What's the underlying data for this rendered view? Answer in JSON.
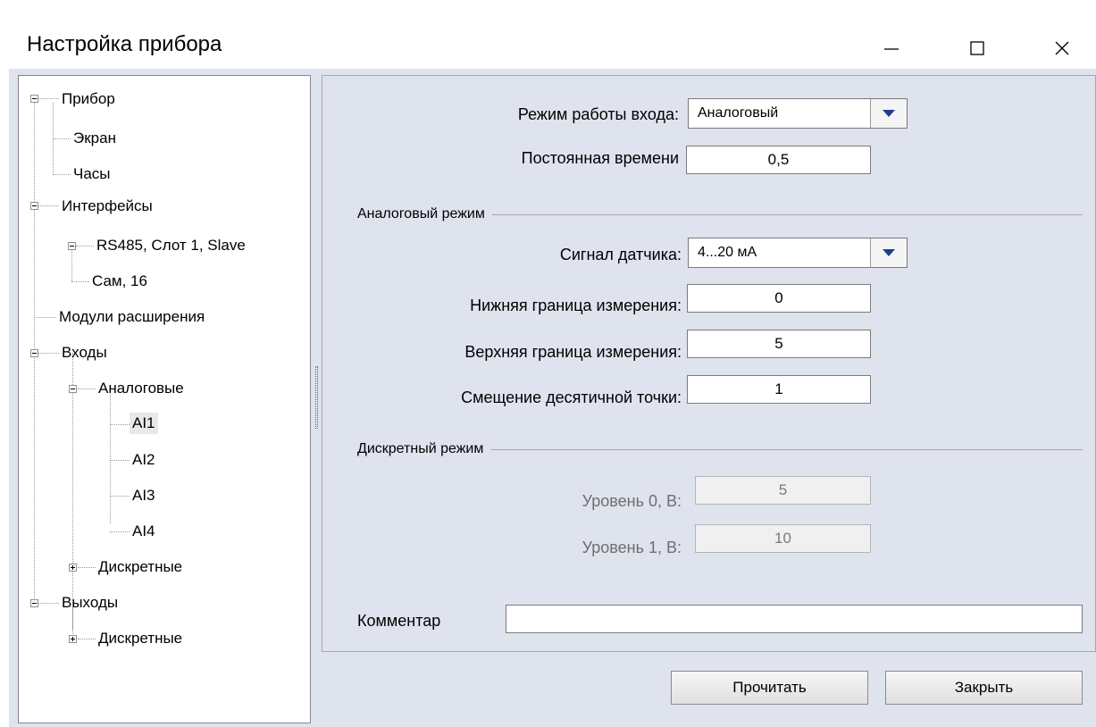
{
  "window": {
    "title": "Настройка прибора",
    "minimize_glyph": "—",
    "maximize_glyph": "☐",
    "close_glyph": "✕"
  },
  "tree": {
    "device": "Прибор",
    "screen": "Экран",
    "clock": "Часы",
    "interfaces": "Интерфейсы",
    "rs485": "RS485, Слот 1, Slave",
    "cam": "Сам, 16",
    "ext_modules": "Модули расширения",
    "inputs": "Входы",
    "analog": "Аналоговые",
    "ai1": "AI1",
    "ai2": "AI2",
    "ai3": "AI3",
    "ai4": "AI4",
    "discrete_in": "Дискретные",
    "outputs": "Выходы",
    "discrete_out": "Дискретные"
  },
  "form": {
    "mode_label": "Режим работы входа:",
    "mode_value": "Аналоговый",
    "time_const_label": "Постоянная времени",
    "time_const_value": "0,5",
    "analog_group": "Аналоговый режим",
    "sensor_label": "Сигнал датчика:",
    "sensor_value": "4...20 мА",
    "lower_label": "Нижняя граница измерения:",
    "lower_value": "0",
    "upper_label": "Верхняя граница измерения:",
    "upper_value": "5",
    "decimal_label": "Смещение десятичной точки:",
    "decimal_value": "1",
    "discrete_group": "Дискретный режим",
    "level0_label": "Уровень 0, В:",
    "level0_value": "5",
    "level1_label": "Уровень 1, В:",
    "level1_value": "10",
    "comment_label": "Комментар",
    "comment_value": ""
  },
  "buttons": {
    "read": "Прочитать",
    "close": "Закрыть"
  }
}
